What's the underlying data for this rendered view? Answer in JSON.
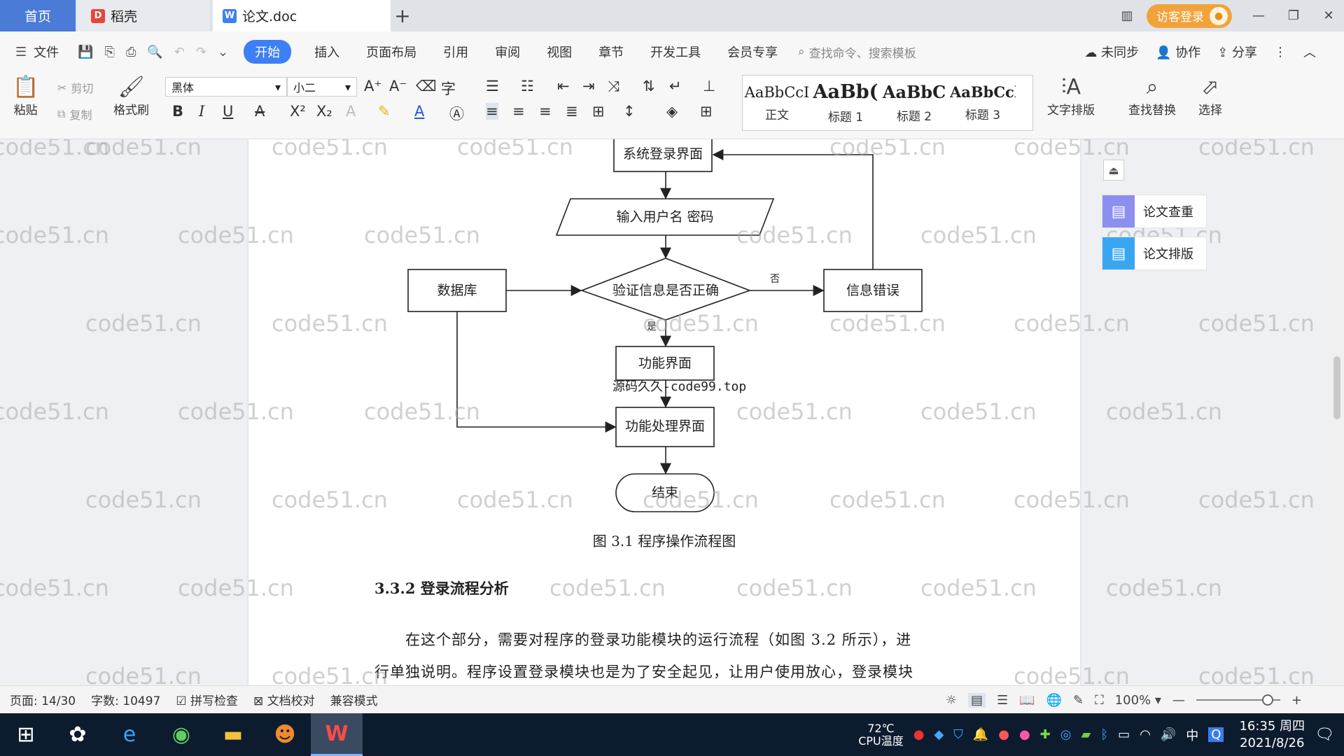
{
  "tabs": {
    "home": "首页",
    "daoke": "稻壳",
    "doc": "论文.doc",
    "add": "+"
  },
  "login": {
    "label": "访客登录"
  },
  "menu": {
    "file": "文件",
    "items": [
      "开始",
      "插入",
      "页面布局",
      "引用",
      "审阅",
      "视图",
      "章节",
      "开发工具",
      "会员专享"
    ],
    "search_placeholder": "查找命令、搜索模板",
    "right": {
      "sync": "未同步",
      "collab": "协作",
      "share": "分享"
    }
  },
  "ribbon": {
    "paste": "粘贴",
    "cut": "剪切",
    "copy": "复制",
    "format_painter": "格式刷",
    "font": "黑体",
    "size": "小二",
    "styles": [
      {
        "preview": "AaBbCcI",
        "label": "正文"
      },
      {
        "preview": "AaBb(",
        "label": "标题 1"
      },
      {
        "preview": "AaBbC",
        "label": "标题 2"
      },
      {
        "preview": "AaBbCcl",
        "label": "标题 3"
      }
    ],
    "text_layout": "文字排版",
    "find_replace": "查找替换",
    "select": "选择"
  },
  "side": {
    "check": "论文查重",
    "layout": "论文排版"
  },
  "watermark": "code51.cn",
  "flowchart": {
    "login": "系统登录界面",
    "input": "输入用户名 密码",
    "db": "数据库",
    "verify": "验证信息是否正确",
    "no": "否",
    "error": "信息错误",
    "yes": "是",
    "func": "功能界面",
    "proc": "功能处理界面",
    "end": "结束"
  },
  "overlay": "源码久久-code99.top",
  "caption": "图 3.1  程序操作流程图",
  "heading": "3.3.2  登录流程分析",
  "paragraph": {
    "line1": "在这个部分，需要对程序的登录功能模块的运行流程（如图 3.2 所示），进",
    "line2": "行单独说明。程序设置登录模块也是为了安全起见，让用户使用放心，登录模块"
  },
  "status": {
    "page": "页面: 14/30",
    "words": "字数: 10497",
    "spell": "拼写检查",
    "proof": "文档校对",
    "compat": "兼容模式",
    "zoom": "100%"
  },
  "taskbar": {
    "temp": "72℃",
    "cpu": "CPU温度",
    "ime": "中",
    "time": "16:35 周四",
    "date": "2021/8/26"
  }
}
